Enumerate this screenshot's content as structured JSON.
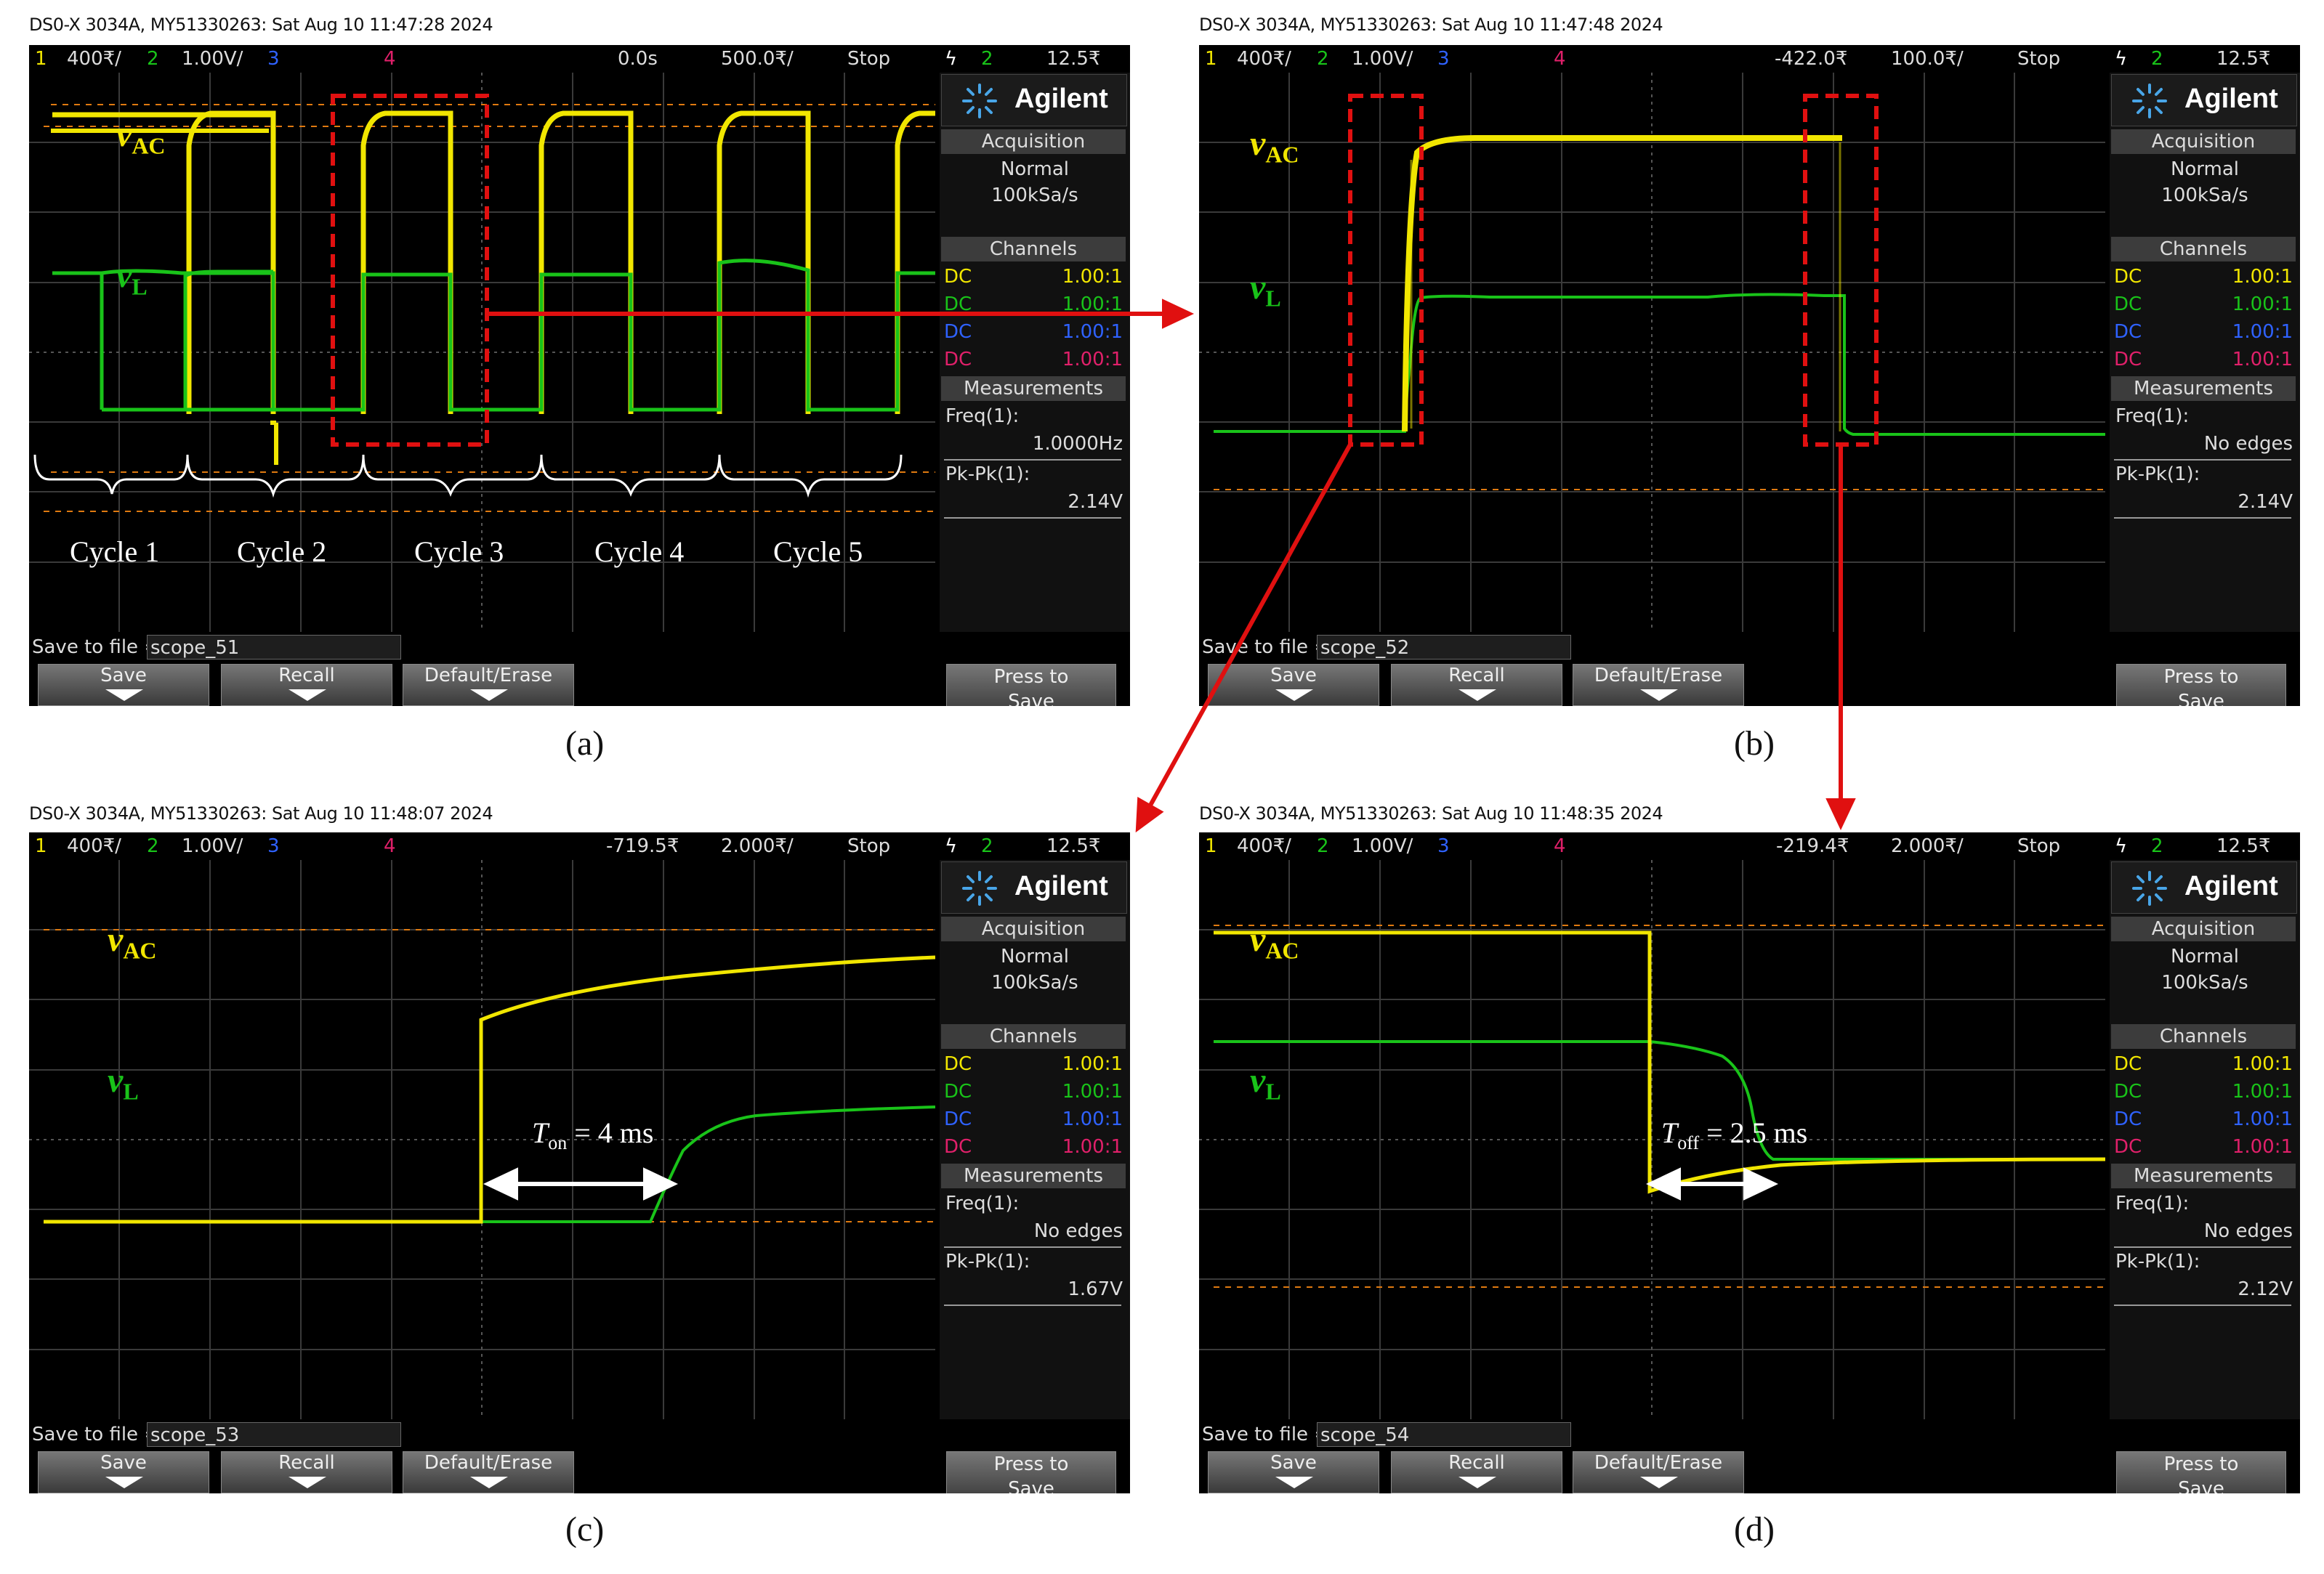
{
  "panels": [
    {
      "header": "DS0-X 3034A, MY51330263: Sat Aug 10 11:47:28 2024",
      "status": {
        "ch1_num": "1",
        "ch1_scale": "400₹/",
        "ch2_num": "2",
        "ch2_scale": "1.00V/",
        "ch3_num": "3",
        "ch4_num": "4",
        "delay": "0.0s",
        "timebase": "500.0₹/",
        "run_state": "Stop",
        "trigger_ch": "2",
        "trigger_level": "12.5₹"
      },
      "logo": "Agilent",
      "acquisition": {
        "title": "Acquisition",
        "mode": "Normal",
        "rate": "100kSa/s"
      },
      "channels": {
        "title": "Channels",
        "rows": [
          {
            "coupling": "DC",
            "ratio": "1.00:1",
            "color": "#f1e600"
          },
          {
            "coupling": "DC",
            "ratio": "1.00:1",
            "color": "#19c319"
          },
          {
            "coupling": "DC",
            "ratio": "1.00:1",
            "color": "#2f62ff"
          },
          {
            "coupling": "DC",
            "ratio": "1.00:1",
            "color": "#e0206a"
          }
        ]
      },
      "measurements": {
        "title": "Measurements",
        "freq_label": "Freq(1):",
        "freq_value": "1.0000Hz",
        "pkpk_label": "Pk-Pk(1):",
        "pkpk_value": "2.14V"
      },
      "save_to_file_label": "Save to file =",
      "file_name": "scope_51",
      "buttons": {
        "save": "Save",
        "recall": "Recall",
        "default_erase": "Default/Erase",
        "press_to_save_1": "Press to",
        "press_to_save_2": "Save"
      },
      "sublabel": "(a)",
      "cycles": [
        "Cycle 1",
        "Cycle 2",
        "Cycle 3",
        "Cycle 4",
        "Cycle 5"
      ]
    },
    {
      "header": "DS0-X 3034A, MY51330263: Sat Aug 10 11:47:48 2024",
      "status": {
        "ch1_num": "1",
        "ch1_scale": "400₹/",
        "ch2_num": "2",
        "ch2_scale": "1.00V/",
        "ch3_num": "3",
        "ch4_num": "4",
        "delay": "-422.0₹",
        "timebase": "100.0₹/",
        "run_state": "Stop",
        "trigger_ch": "2",
        "trigger_level": "12.5₹"
      },
      "logo": "Agilent",
      "acquisition": {
        "title": "Acquisition",
        "mode": "Normal",
        "rate": "100kSa/s"
      },
      "channels": {
        "title": "Channels",
        "rows": [
          {
            "coupling": "DC",
            "ratio": "1.00:1",
            "color": "#f1e600"
          },
          {
            "coupling": "DC",
            "ratio": "1.00:1",
            "color": "#19c319"
          },
          {
            "coupling": "DC",
            "ratio": "1.00:1",
            "color": "#2f62ff"
          },
          {
            "coupling": "DC",
            "ratio": "1.00:1",
            "color": "#e0206a"
          }
        ]
      },
      "measurements": {
        "title": "Measurements",
        "freq_label": "Freq(1):",
        "freq_value": "No edges",
        "pkpk_label": "Pk-Pk(1):",
        "pkpk_value": "2.14V"
      },
      "save_to_file_label": "Save to file =",
      "file_name": "scope_52",
      "buttons": {
        "save": "Save",
        "recall": "Recall",
        "default_erase": "Default/Erase",
        "press_to_save_1": "Press to",
        "press_to_save_2": "Save"
      },
      "sublabel": "(b)"
    },
    {
      "header": "DS0-X 3034A, MY51330263: Sat Aug 10 11:48:07 2024",
      "status": {
        "ch1_num": "1",
        "ch1_scale": "400₹/",
        "ch2_num": "2",
        "ch2_scale": "1.00V/",
        "ch3_num": "3",
        "ch4_num": "4",
        "delay": "-719.5₹",
        "timebase": "2.000₹/",
        "run_state": "Stop",
        "trigger_ch": "2",
        "trigger_level": "12.5₹"
      },
      "logo": "Agilent",
      "acquisition": {
        "title": "Acquisition",
        "mode": "Normal",
        "rate": "100kSa/s"
      },
      "channels": {
        "title": "Channels",
        "rows": [
          {
            "coupling": "DC",
            "ratio": "1.00:1",
            "color": "#f1e600"
          },
          {
            "coupling": "DC",
            "ratio": "1.00:1",
            "color": "#19c319"
          },
          {
            "coupling": "DC",
            "ratio": "1.00:1",
            "color": "#2f62ff"
          },
          {
            "coupling": "DC",
            "ratio": "1.00:1",
            "color": "#e0206a"
          }
        ]
      },
      "measurements": {
        "title": "Measurements",
        "freq_label": "Freq(1):",
        "freq_value": "No edges",
        "pkpk_label": "Pk-Pk(1):",
        "pkpk_value": "1.67V"
      },
      "save_to_file_label": "Save to file =",
      "file_name": "scope_53",
      "buttons": {
        "save": "Save",
        "recall": "Recall",
        "default_erase": "Default/Erase",
        "press_to_save_1": "Press to",
        "press_to_save_2": "Save"
      },
      "sublabel": "(c)",
      "time_label": {
        "symbol": "T",
        "sub": "on",
        "rest": " = 4 ms"
      }
    },
    {
      "header": "DS0-X 3034A, MY51330263: Sat Aug 10 11:48:35 2024",
      "status": {
        "ch1_num": "1",
        "ch1_scale": "400₹/",
        "ch2_num": "2",
        "ch2_scale": "1.00V/",
        "ch3_num": "3",
        "ch4_num": "4",
        "delay": "-219.4₹",
        "timebase": "2.000₹/",
        "run_state": "Stop",
        "trigger_ch": "2",
        "trigger_level": "12.5₹"
      },
      "logo": "Agilent",
      "acquisition": {
        "title": "Acquisition",
        "mode": "Normal",
        "rate": "100kSa/s"
      },
      "channels": {
        "title": "Channels",
        "rows": [
          {
            "coupling": "DC",
            "ratio": "1.00:1",
            "color": "#f1e600"
          },
          {
            "coupling": "DC",
            "ratio": "1.00:1",
            "color": "#19c319"
          },
          {
            "coupling": "DC",
            "ratio": "1.00:1",
            "color": "#2f62ff"
          },
          {
            "coupling": "DC",
            "ratio": "1.00:1",
            "color": "#e0206a"
          }
        ]
      },
      "measurements": {
        "title": "Measurements",
        "freq_label": "Freq(1):",
        "freq_value": "No edges",
        "pkpk_label": "Pk-Pk(1):",
        "pkpk_value": "2.12V"
      },
      "save_to_file_label": "Save to file =",
      "file_name": "scope_54",
      "buttons": {
        "save": "Save",
        "recall": "Recall",
        "default_erase": "Default/Erase",
        "press_to_save_1": "Press to",
        "press_to_save_2": "Save"
      },
      "sublabel": "(d)",
      "time_label": {
        "symbol": "T",
        "sub": "off",
        "rest": " = 2.5 ms"
      }
    }
  ],
  "wave_labels": {
    "vac_symbol": "v",
    "vac_sub": "AC",
    "vl_symbol": "v",
    "vl_sub": "L"
  },
  "colors": {
    "ch1": "#f1e600",
    "ch2": "#19c319",
    "ch3": "#2f62ff",
    "ch4": "#e0206a",
    "annotation_red": "#e01010",
    "ref_orange": "#e07a10"
  }
}
